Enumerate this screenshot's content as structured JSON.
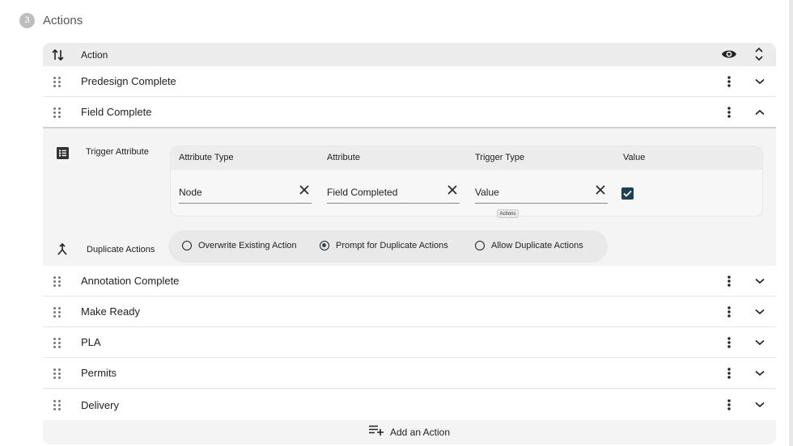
{
  "section": {
    "step": "3",
    "title": "Actions"
  },
  "table": {
    "header_label": "Action"
  },
  "rows": [
    {
      "label": "Predesign Complete",
      "expanded": false
    },
    {
      "label": "Field Complete",
      "expanded": true
    },
    {
      "label": "Annotation Complete",
      "expanded": false
    },
    {
      "label": "Make Ready",
      "expanded": false
    },
    {
      "label": "PLA",
      "expanded": false
    },
    {
      "label": "Permits",
      "expanded": false
    },
    {
      "label": "Delivery",
      "expanded": false
    }
  ],
  "trigger": {
    "label": "Trigger Attribute",
    "columns": [
      "Attribute Type",
      "Attribute",
      "Trigger Type",
      "Value"
    ],
    "values": {
      "attribute_type": "Node",
      "attribute": "Field Completed",
      "trigger_type": "Value",
      "checked": true
    }
  },
  "tooltip": "Actions",
  "duplicate": {
    "label": "Duplicate Actions",
    "options": [
      "Overwrite Existing Action",
      "Prompt for Duplicate Actions",
      "Allow Duplicate Actions"
    ],
    "selected": "Prompt for Duplicate Actions"
  },
  "add_action_label": "Add an Action",
  "colors": {
    "accent": "#1f3f52",
    "panel_bg": "#f4f4f4",
    "header_bg": "#ececec"
  }
}
